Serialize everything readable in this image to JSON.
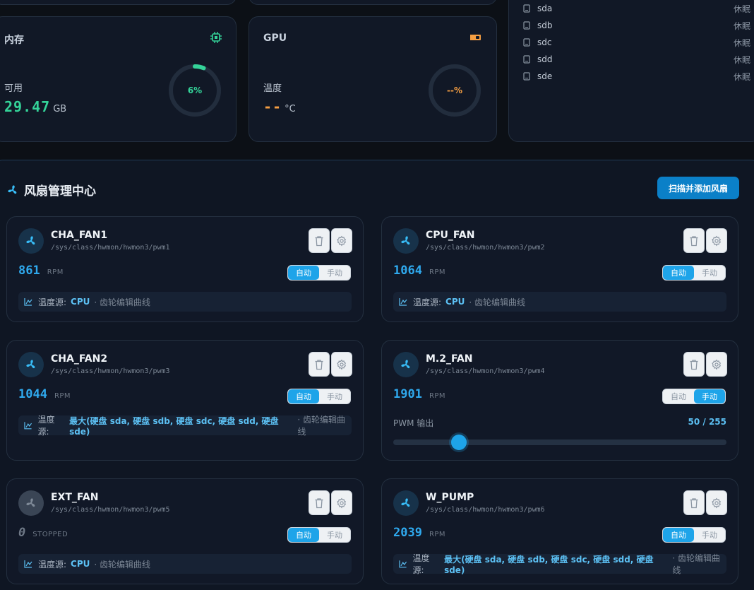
{
  "memory": {
    "title": "内存",
    "label": "可用",
    "value": "29.47",
    "unit": "GB",
    "percent": 6,
    "percent_text": "6%"
  },
  "gpu": {
    "title": "GPU",
    "label": "温度",
    "value": "--",
    "unit": "°C",
    "percent_text": "--%"
  },
  "disks": [
    {
      "name": "sda",
      "state": "休眠"
    },
    {
      "name": "sdb",
      "state": "休眠"
    },
    {
      "name": "sdc",
      "state": "休眠"
    },
    {
      "name": "sdd",
      "state": "休眠"
    },
    {
      "name": "sde",
      "state": "休眠"
    }
  ],
  "fan_panel": {
    "title": "风扇管理中心",
    "scan_button": "扫描并添加风扇"
  },
  "mode_labels": {
    "auto": "自动",
    "manual": "手动"
  },
  "source_label": "温度源:",
  "source_hint": "· 齿轮编辑曲线",
  "pwm_label": "PWM 输出",
  "fans": [
    {
      "name": "CHA_FAN1",
      "path": "/sys/class/hwmon/hwmon3/pwm1",
      "rpm": "861",
      "rpm_unit": "RPM",
      "mode": "auto",
      "source": "CPU"
    },
    {
      "name": "CPU_FAN",
      "path": "/sys/class/hwmon/hwmon3/pwm2",
      "rpm": "1064",
      "rpm_unit": "RPM",
      "mode": "auto",
      "source": "CPU"
    },
    {
      "name": "CHA_FAN2",
      "path": "/sys/class/hwmon/hwmon3/pwm3",
      "rpm": "1044",
      "rpm_unit": "RPM",
      "mode": "auto",
      "source": "最大(硬盘 sda, 硬盘 sdb, 硬盘 sdc, 硬盘 sdd, 硬盘 sde)"
    },
    {
      "name": "M.2_FAN",
      "path": "/sys/class/hwmon/hwmon3/pwm4",
      "rpm": "1901",
      "rpm_unit": "RPM",
      "mode": "manual",
      "pwm": 50,
      "pwm_max": 255,
      "pwm_text": "50 / 255"
    },
    {
      "name": "EXT_FAN",
      "path": "/sys/class/hwmon/hwmon3/pwm5",
      "rpm": "0",
      "rpm_unit": "STOPPED",
      "mode": "auto",
      "source": "CPU",
      "stopped": true
    },
    {
      "name": "W_PUMP",
      "path": "/sys/class/hwmon/hwmon3/pwm6",
      "rpm": "2039",
      "rpm_unit": "RPM",
      "mode": "auto",
      "source": "最大(硬盘 sda, 硬盘 sdb, 硬盘 sdc, 硬盘 sdd, 硬盘 sde)"
    }
  ],
  "colors": {
    "accent": "#1ea4e9",
    "memory": "#34d399",
    "gpu": "#f59e42"
  }
}
